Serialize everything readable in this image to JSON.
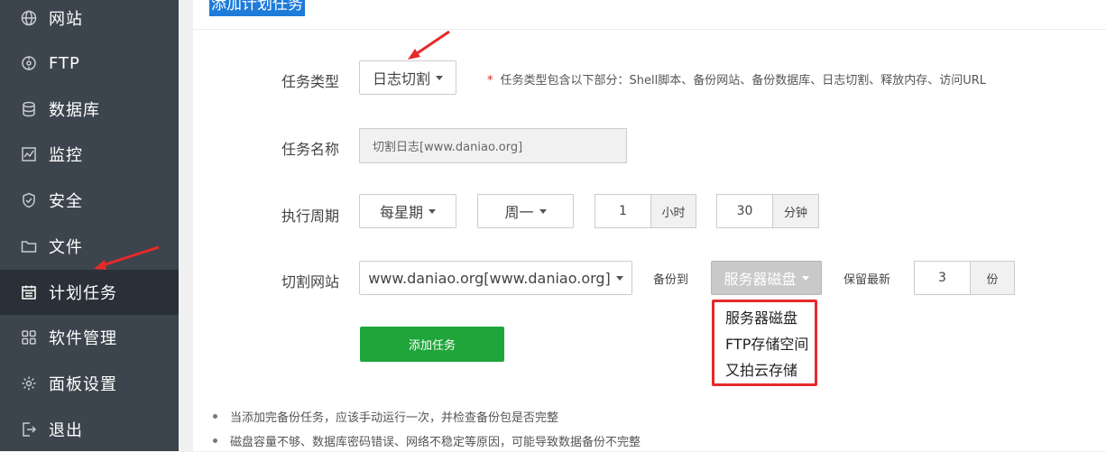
{
  "sidebar": {
    "items": [
      {
        "label": "网站",
        "icon": "globe-icon"
      },
      {
        "label": "FTP",
        "icon": "ftp-icon"
      },
      {
        "label": "数据库",
        "icon": "database-icon"
      },
      {
        "label": "监控",
        "icon": "monitor-icon"
      },
      {
        "label": "安全",
        "icon": "shield-icon"
      },
      {
        "label": "文件",
        "icon": "folder-icon"
      },
      {
        "label": "计划任务",
        "icon": "calendar-icon",
        "active": true
      },
      {
        "label": "软件管理",
        "icon": "grid-icon"
      },
      {
        "label": "面板设置",
        "icon": "gear-icon"
      },
      {
        "label": "退出",
        "icon": "logout-icon"
      }
    ]
  },
  "main": {
    "title": "添加计划任务",
    "form": {
      "task_type_label": "任务类型",
      "task_type_value": "日志切割",
      "task_type_hint_star": "*",
      "task_type_hint": "任务类型包含以下部分：Shell脚本、备份网站、备份数据库、日志切割、释放内存、访问URL",
      "task_name_label": "任务名称",
      "task_name_value": "切割日志[www.daniao.org]",
      "period_label": "执行周期",
      "period_value": "每星期",
      "weekday_value": "周一",
      "hour_value": "1",
      "hour_unit": "小时",
      "minute_value": "30",
      "minute_unit": "分钟",
      "site_label": "切割网站",
      "site_value": "www.daniao.org[www.daniao.org]",
      "backup_to_label": "备份到",
      "backup_to_value": "服务器磁盘",
      "keep_latest_label": "保留最新",
      "keep_value": "3",
      "keep_unit": "份",
      "backup_options": [
        "服务器磁盘",
        "FTP存储空间",
        "又拍云存储"
      ],
      "submit_label": "添加任务"
    },
    "notes": [
      "当添加完备份任务，应该手动运行一次，并检查备份包是否完整",
      "磁盘容量不够、数据库密码错误、网络不稳定等原因，可能导致数据备份不完整"
    ]
  },
  "colors": {
    "sidebar_bg": "#3c444d",
    "sidebar_active": "#2a3037",
    "accent_green": "#20a53a",
    "highlight_red": "#e52a2a",
    "selection_blue": "#1e7bd9"
  }
}
